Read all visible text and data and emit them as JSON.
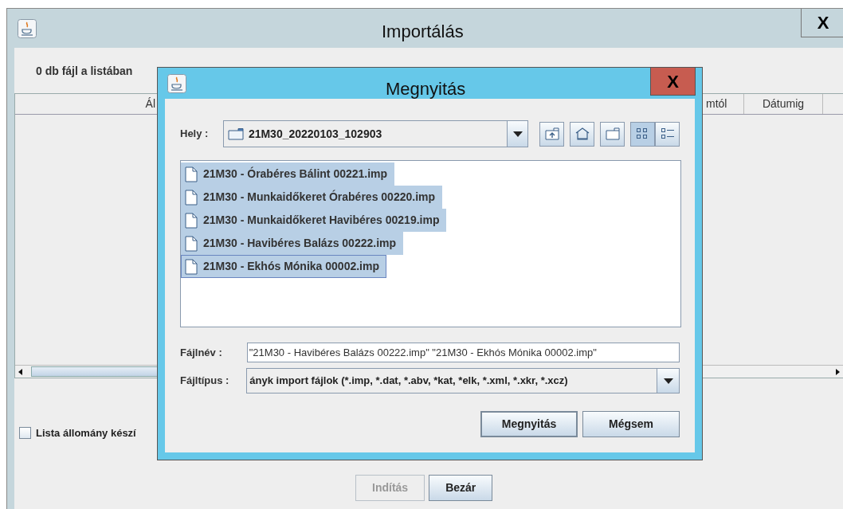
{
  "window": {
    "title": "Importálás",
    "close_label": "X"
  },
  "file_count_label": "0 db fájl a listában",
  "table": {
    "columns": [
      "Ál",
      "mtól",
      "Dátumig"
    ]
  },
  "list_file_checkbox": {
    "label": "Lista állomány készí",
    "checked": false
  },
  "buttons": [
    {
      "label": "Indítás",
      "disabled": true
    },
    {
      "label": "Bezár",
      "disabled": false
    }
  ],
  "dialog": {
    "title": "Megnyitás",
    "close_label": "X",
    "location_label": "Hely :",
    "location": "21M30_20220103_102903",
    "toolbar": [
      {
        "kind": "up",
        "selected": false
      },
      {
        "kind": "home",
        "selected": false
      },
      {
        "kind": "newfolder",
        "selected": false
      },
      {
        "kind": "list",
        "selected": true
      },
      {
        "kind": "details",
        "selected": false
      }
    ],
    "files": [
      {
        "name": "21M30 - Órabéres Bálint 00221.imp",
        "selected": true,
        "focused": false
      },
      {
        "name": "21M30 - Munkaidőkeret Órabéres 00220.imp",
        "selected": true,
        "focused": false
      },
      {
        "name": "21M30 - Munkaidőkeret Havibéres 00219.imp",
        "selected": true,
        "focused": false
      },
      {
        "name": "21M30 - Havibéres Balázs 00222.imp",
        "selected": true,
        "focused": false
      },
      {
        "name": "21M30 - Ekhós Mónika 00002.imp",
        "selected": true,
        "focused": true
      }
    ],
    "file_name_label": "Fájlnév :",
    "file_name": "\"21M30 - Havibéres Balázs 00222.imp\" \"21M30 - Ekhós Mónika 00002.imp\"",
    "file_type_label": "Fájltípus :",
    "file_type": "ányk import fájlok (*.imp, *.dat, *.abv, *kat, *elk, *.xml, *.xkr, *.xcz)",
    "buttons": [
      {
        "label": "Megnyitás",
        "default": true
      },
      {
        "label": "Mégsem",
        "default": false
      }
    ]
  }
}
